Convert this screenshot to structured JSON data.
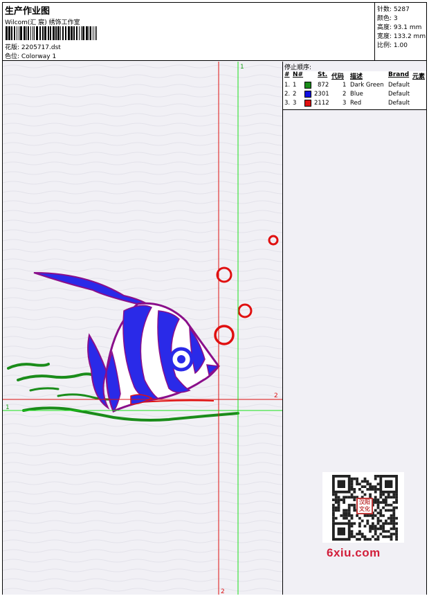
{
  "header": {
    "title": "生产作业图",
    "subtitle": "Wilcom(汇 宸) 绣饰工作室",
    "design_label": "花版:",
    "design_value": "2205717.dst",
    "colorway_label": "色位:",
    "colorway_value": "Colorway 1"
  },
  "stats": {
    "stitches_label": "针数:",
    "stitches_value": "5287",
    "colors_label": "颜色:",
    "colors_value": "3",
    "height_label": "高度:",
    "height_value": "93.1 mm",
    "width_label": "宽度:",
    "width_value": "133.2 mm",
    "scale_label": "比例:",
    "scale_value": "1.00"
  },
  "stop_sequence": {
    "header": "停止顺序:",
    "columns": {
      "index": "#",
      "needle": "N#",
      "stitches": "St.",
      "code": "代码",
      "description": "描述",
      "brand": "Brand",
      "element": "元素"
    },
    "rows": [
      {
        "index": "1.",
        "needle": "1",
        "color": "#1a8c1a",
        "stitches": "872",
        "code": "1",
        "description": "Dark Green",
        "brand": "Default"
      },
      {
        "index": "2.",
        "needle": "2",
        "color": "#1010e0",
        "stitches": "2301",
        "code": "2",
        "description": "Blue",
        "brand": "Default"
      },
      {
        "index": "3.",
        "needle": "3",
        "color": "#e01010",
        "stitches": "2112",
        "code": "3",
        "description": "Red",
        "brand": "Default"
      }
    ]
  },
  "guides": {
    "green_top_label": "1",
    "green_left_label": "1",
    "red_right_label": "2",
    "red_bottom_label": "2"
  },
  "colors": {
    "green": "#1a8c1a",
    "blue": "#1010e0",
    "red": "#e01010",
    "guide_green": "#19e019",
    "guide_red": "#dd1010"
  },
  "watermark": {
    "seal_text": "汉阳文化",
    "caption": "6xiu.com"
  }
}
